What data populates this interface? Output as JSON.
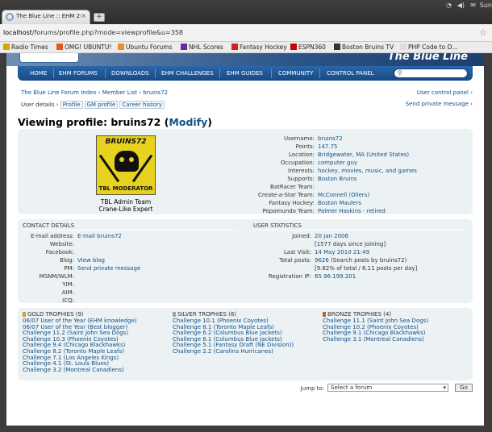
{
  "browser": {
    "tab_title": "The Blue Line :: EHM 200...",
    "tab_close": "×",
    "new_tab": "+",
    "tray_user": "Sun",
    "url_host": "localhost",
    "url_path": "/forums/profile.php?mode=viewprofile&u=358",
    "bookmarks": [
      {
        "label": "Radio Times",
        "icon_color": "#d9a400"
      },
      {
        "label": "OMG! UBUNTU!",
        "icon_color": "#e05a1b"
      },
      {
        "label": "Ubuntu Forums",
        "icon_color": "#e8902a"
      },
      {
        "label": "NHL Scores",
        "icon_color": "#6a2ba0"
      },
      {
        "label": "Fantasy Hockey",
        "icon_color": "#d02020"
      },
      {
        "label": "ESPN360",
        "icon_color": "#cc0000"
      },
      {
        "label": "Boston Bruins TV",
        "icon_color": "#333333"
      },
      {
        "label": "PHP Code to D...",
        "icon_color": "#dddddd"
      }
    ]
  },
  "site": {
    "name": "The Blue Line",
    "nav": [
      "HOME",
      "EHM FORUMS",
      "DOWNLOADS",
      "EHM CHALLENGES",
      "EHM GUIDES",
      "COMMUNITY",
      "CONTROL PANEL"
    ]
  },
  "breadcrumb": {
    "index": "The Blue Line Forum Index",
    "sep1": "‹",
    "members": "Member List",
    "sep2": "‹",
    "user": "bruins72",
    "ucp": "User control panel ›",
    "details_label": "User details ›",
    "tabs": [
      "Profile",
      "GM profile",
      "Career history"
    ],
    "send_pm": "Send private message ›"
  },
  "profile": {
    "heading_prefix": "Viewing profile: bruins72 (",
    "modify": "Modify",
    "heading_suffix": ")",
    "avatar_top": "BRUINS72",
    "avatar_bottom": "TBL MODERATOR",
    "rank1": "TBL Admin Team",
    "rank2": "Crane-Like Expert",
    "fields": [
      {
        "label": "Username:",
        "value": "bruins72"
      },
      {
        "label": "Points:",
        "value": "147.75"
      },
      {
        "label": "Location:",
        "value": "Bridgewater, MA (United States)"
      },
      {
        "label": "Occupation:",
        "value": "computer guy"
      },
      {
        "label": "Interests:",
        "value": "hockey, movies, music, and games"
      },
      {
        "label": "Supports:",
        "value": "Boston Bruins"
      },
      {
        "label": "BatRacer Team:",
        "value": ""
      },
      {
        "label": "Create-a-Star Team:",
        "value": "McConnell (Oilers)"
      },
      {
        "label": "Fantasy Hockey:",
        "value": "Boston Maulers"
      },
      {
        "label": "Popomundo Team:",
        "value": "Palmer Haskins - retired"
      }
    ]
  },
  "contact": {
    "title": "CONTACT DETAILS",
    "rows": [
      {
        "label": "E-mail address:",
        "value": "E-mail bruins72"
      },
      {
        "label": "Website:",
        "value": ""
      },
      {
        "label": "Facebook:",
        "value": ""
      },
      {
        "label": "Blog:",
        "value": "View blog"
      },
      {
        "label": "PM:",
        "value": "Send private message"
      },
      {
        "label": "MSNM/WLM:",
        "value": ""
      },
      {
        "label": "YIM:",
        "value": ""
      },
      {
        "label": "AIM:",
        "value": ""
      },
      {
        "label": "ICQ:",
        "value": ""
      }
    ]
  },
  "stats": {
    "title": "USER STATISTICS",
    "joined_label": "Joined:",
    "joined": "20 Jan 2006",
    "joined_note": "[1577 days since joining]",
    "lastvisit_label": "Last Visit:",
    "lastvisit": "14 May 2010 21:49",
    "posts_label": "Total posts:",
    "posts": "9626",
    "posts_search": "(Search posts by bruins72)",
    "posts_note": "[9.82% of total / 6.11 posts per day]",
    "ip_label": "Registration IP:",
    "ip": "65.96.199.201"
  },
  "trophies": {
    "gold": {
      "title": "GOLD TROPHIES (9)",
      "color": "#d4a017",
      "items": [
        "06/07 User of the Year (EHM knowledge)",
        "06/07 User of the Year (Best blogger)",
        "Challenge 11.2 (Saint John Sea Dogs)",
        "Challenge 10.3 (Phoenix Coyotes)",
        "Challenge 9.4 (Chicago Blackhawks)",
        "Challenge 8.2 (Toronto Maple Leafs)",
        "Challenge 7.1 (Los Angeles Kings)",
        "Challenge 4.1 (St. Louis Blues)",
        "Challenge 3.2 (Montreal Canadiens)"
      ]
    },
    "silver": {
      "title": "SILVER TROPHIES (6)",
      "color": "#a0a0a0",
      "items": [
        "Challenge 10.1 (Phoenix Coyotes)",
        "Challenge 8.1 (Toronto Maple Leafs)",
        "Challenge 6.2 (Columbus Blue Jackets)",
        "Challenge 6.1 (Columbus Blue Jackets)",
        "Challenge 5.1 (Fantasy Draft (NE Division))",
        "Challenge 2.2 (Carolina Hurricanes)"
      ]
    },
    "bronze": {
      "title": "BRONZE TROPHIES (4)",
      "color": "#b5651d",
      "items": [
        "Challenge 11.1 (Saint John Sea Dogs)",
        "Challenge 10.2 (Phoenix Coyotes)",
        "Challenge 9.1 (Chicago Blackhawks)",
        "Challenge 3.1 (Montreal Canadiens)"
      ]
    }
  },
  "jump": {
    "label": "Jump to:",
    "selected": "Select a forum",
    "go": "Go"
  }
}
